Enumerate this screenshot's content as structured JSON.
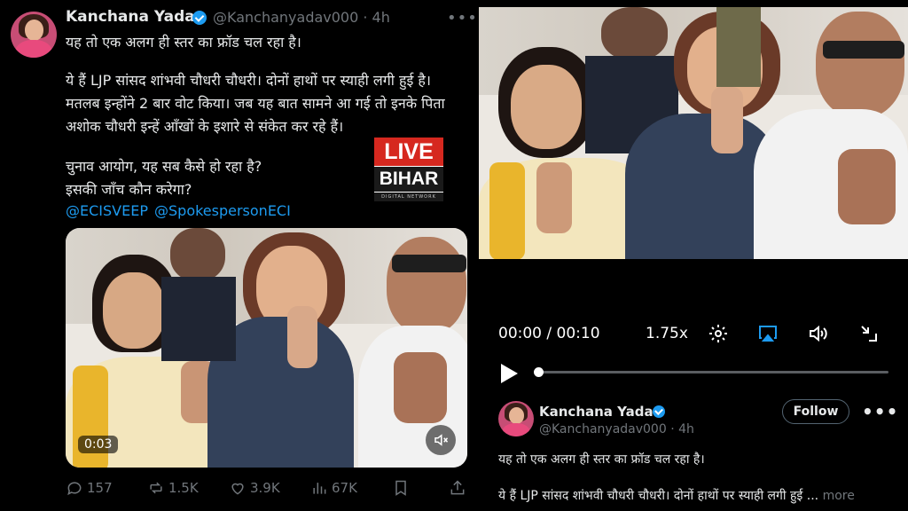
{
  "left": {
    "author": {
      "name": "Kanchana Yadav",
      "handle": "@Kanchanyadav000",
      "time": "· 4h",
      "more": "•••"
    },
    "tweet": {
      "line1": "यह तो एक अलग ही स्तर का फ्रॉड चल रहा है।",
      "line2": "ये हैं LJP सांसद शांभवी चौधरी चौधरी। दोनों हाथों पर स्याही लगी हुई है।",
      "line3": "मतलब इन्होंने 2 बार वोट किया। जब यह बात सामने आ गई तो इनके पिता",
      "line4": "अशोक चौधरी इन्हें आँखों के इशारे से संकेत कर रहे हैं।",
      "line5": "चुनाव आयोग, यह सब कैसे हो रहा है?",
      "line6": "इसकी जाँच कौन करेगा?",
      "mention1": "@ECISVEEP",
      "mention2": "@SpokespersonECI"
    },
    "logo": {
      "live": "LIVE",
      "bihar": "BIHAR",
      "sub": "DIGITAL NETWORK"
    },
    "video": {
      "timer": "0:03",
      "mute_icon": "speaker-muted-icon"
    },
    "actions": {
      "replies": "157",
      "reposts": "1.5K",
      "likes": "3.9K",
      "views": "67K"
    }
  },
  "right": {
    "player": {
      "time": "00:00 / 00:10",
      "speed": "1.75x",
      "progress": 0.0
    },
    "author": {
      "name": "Kanchana Yadav",
      "handle": "@Kanchanyadav000 · 4h",
      "follow": "Follow",
      "more": "•••"
    },
    "tweet": {
      "line1": "यह तो एक अलग ही स्तर का फ्रॉड चल रहा है।",
      "line2": "ये हैं LJP सांसद शांभवी चौधरी चौधरी। दोनों हाथों पर स्याही लगी हुई ...",
      "more": "more"
    }
  },
  "colors": {
    "accent": "#1d9bf0",
    "muted": "#71767b",
    "text": "#e7e9ea",
    "background": "#000000",
    "live_red": "#d6281f"
  }
}
